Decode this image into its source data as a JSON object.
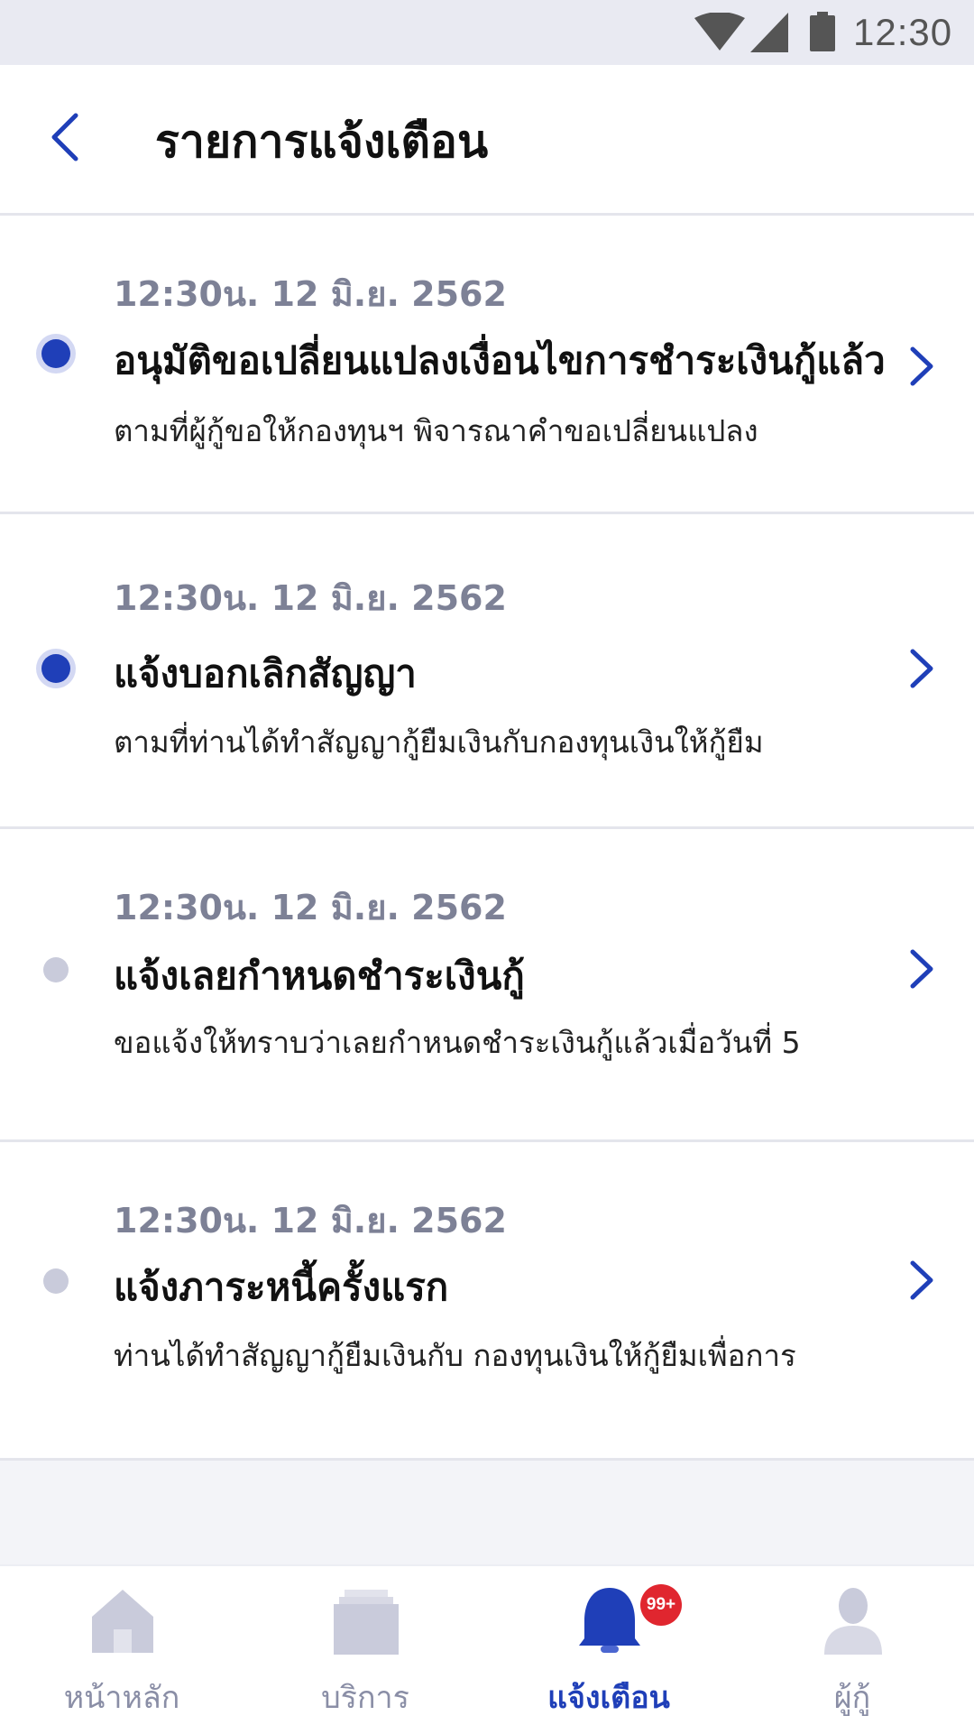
{
  "status_bar": {
    "time": "12:30",
    "icons": [
      "wifi-icon",
      "signal-icon",
      "battery-icon"
    ]
  },
  "header": {
    "title": "รายการแจ้งเตือน",
    "back_icon": "chevron-left-icon"
  },
  "notifications": [
    {
      "time": "12:30น. 12 มิ.ย. 2562",
      "title": "อนุมัติขอเปลี่ยนแปลงเงื่อนไขการชำระเงินกู้แล้ว",
      "description": "ตามที่ผู้กู้ขอให้กองทุนฯ พิจารณาคำขอเปลี่ยนแปลง",
      "unread": true
    },
    {
      "time": "12:30น. 12 มิ.ย. 2562",
      "title": "แจ้งบอกเลิกสัญญา",
      "description": "ตามที่ท่านได้ทำสัญญากู้ยืมเงินกับกองทุนเงินให้กู้ยืม",
      "unread": true
    },
    {
      "time": "12:30น. 12 มิ.ย. 2562",
      "title": "แจ้งเลยกำหนดชำระเงินกู้",
      "description": "ขอแจ้งให้ทราบว่าเลยกำหนดชำระเงินกู้แล้วเมื่อวันที่ 5",
      "unread": false
    },
    {
      "time": "12:30น. 12 มิ.ย. 2562",
      "title": "แจ้งภาระหนี้ครั้งแรก",
      "description": "ท่านได้ทำสัญญากู้ยืมเงินกับ กองทุนเงินให้กู้ยืมเพื่อการ",
      "unread": false
    }
  ],
  "bottom_nav": {
    "tabs": [
      {
        "label": "หน้าหลัก",
        "icon": "home-icon",
        "active": false
      },
      {
        "label": "บริการ",
        "icon": "services-icon",
        "active": false
      },
      {
        "label": "แจ้งเตือน",
        "icon": "bell-icon",
        "active": true,
        "badge": "99+"
      },
      {
        "label": "ผู้กู้",
        "icon": "user-icon",
        "active": false
      }
    ]
  },
  "colors": {
    "accent": "#1f3fb8",
    "badge": "#e0262f",
    "inactive": "#c9cbdb"
  }
}
